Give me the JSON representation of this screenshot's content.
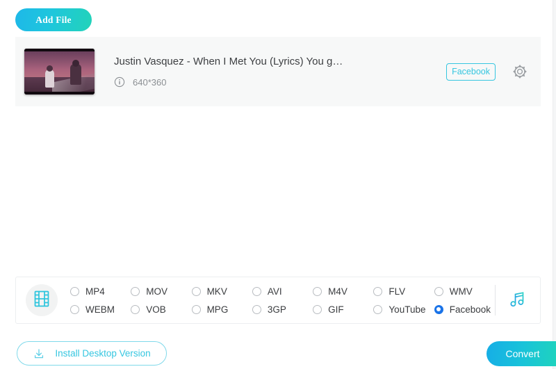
{
  "toolbar": {
    "add_file_label": "Add File"
  },
  "file": {
    "title": "Justin Vasquez - When I Met You (Lyrics) You g…",
    "resolution": "640*360",
    "badge_label": "Facebook",
    "info_icon": "info-icon",
    "gear_icon": "gear-icon",
    "thumbnail_alt": "video-thumbnail"
  },
  "format_panel": {
    "video_icon": "film-strip-icon",
    "audio_icon": "music-note-icon",
    "selected": "Facebook",
    "options": [
      {
        "label": "MP4",
        "selected": false
      },
      {
        "label": "MOV",
        "selected": false
      },
      {
        "label": "MKV",
        "selected": false
      },
      {
        "label": "AVI",
        "selected": false
      },
      {
        "label": "M4V",
        "selected": false
      },
      {
        "label": "FLV",
        "selected": false
      },
      {
        "label": "WMV",
        "selected": false
      },
      {
        "label": "WEBM",
        "selected": false
      },
      {
        "label": "VOB",
        "selected": false
      },
      {
        "label": "MPG",
        "selected": false
      },
      {
        "label": "3GP",
        "selected": false
      },
      {
        "label": "GIF",
        "selected": false
      },
      {
        "label": "YouTube",
        "selected": false
      },
      {
        "label": "Facebook",
        "selected": true
      }
    ]
  },
  "footer": {
    "install_label": "Install Desktop Version",
    "install_icon": "download-icon",
    "convert_label": "Convert"
  },
  "colors": {
    "accent_cyan": "#35c6e0",
    "accent_teal": "#1fd4bc",
    "radio_blue": "#1a73e8",
    "row_bg": "#f7f8f8"
  }
}
